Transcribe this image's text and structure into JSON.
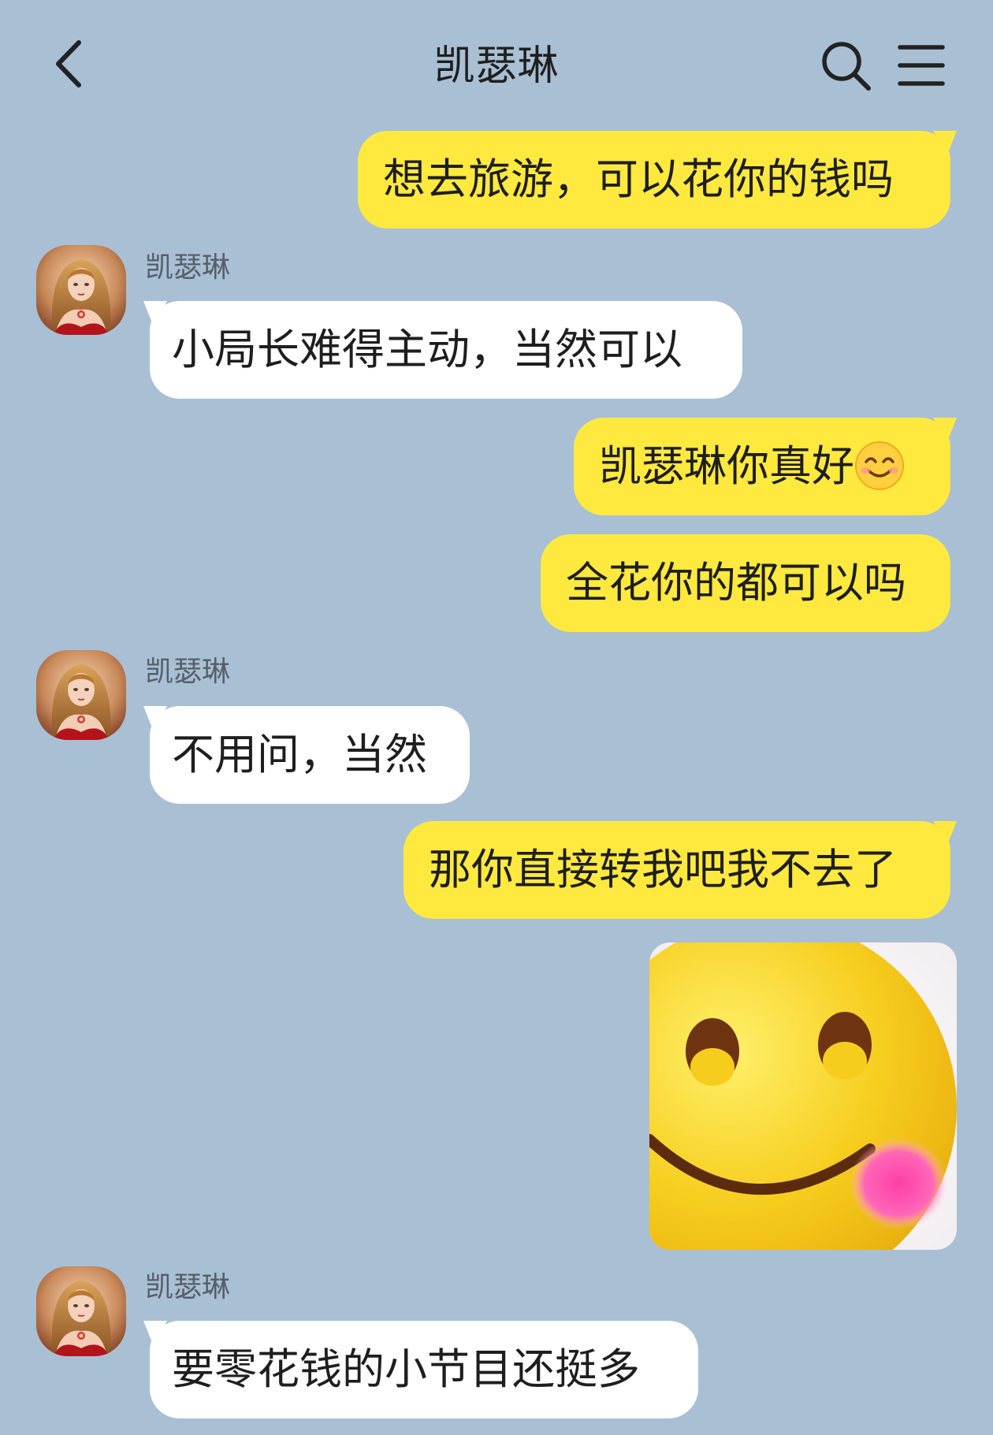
{
  "header": {
    "title": "凯瑟琳",
    "back_icon": "chevron-left-icon",
    "search_icon": "search-icon",
    "menu_icon": "hamburger-menu-icon"
  },
  "colors": {
    "background": "#a9bfd4",
    "my_bubble": "#ffe93f",
    "their_bubble": "#ffffff"
  },
  "messages": [
    {
      "from": "me",
      "text": "想去旅游，可以花你的钱吗"
    },
    {
      "from": "other",
      "sender": "凯瑟琳",
      "text": "小局长难得主动，当然可以"
    },
    {
      "from": "me",
      "text": "凯瑟琳你真好",
      "emoji": "smiling-face-icon"
    },
    {
      "from": "me",
      "text": "全花你的都可以吗"
    },
    {
      "from": "other",
      "sender": "凯瑟琳",
      "text": "不用问，当然"
    },
    {
      "from": "me",
      "text": "那你直接转我吧我不去了"
    },
    {
      "from": "me",
      "type": "sticker",
      "sticker": "blushing-smiley-sticker"
    },
    {
      "from": "other",
      "sender": "凯瑟琳",
      "text": "要零花钱的小节目还挺多"
    }
  ]
}
